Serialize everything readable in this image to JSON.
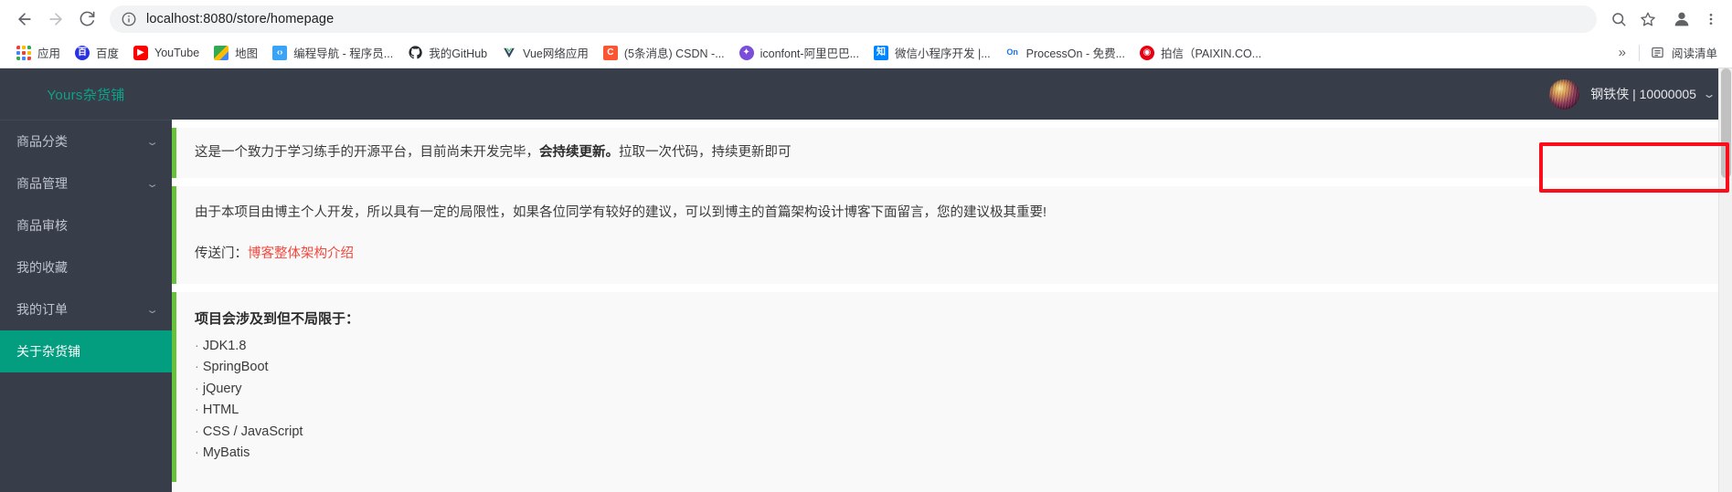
{
  "browser": {
    "url_display": "localhost:8080/store/homepage",
    "url_host": "localhost:8080",
    "url_path": "/store/homepage",
    "nav": {
      "back": "back-button",
      "forward": "forward-button",
      "reload": "reload-button"
    },
    "omnibox_actions": [
      "zoom-icon",
      "bookmark-star-icon"
    ],
    "profile": "profile-avatar-icon",
    "menu": "browser-menu-icon",
    "bookmarks": [
      {
        "label": "应用",
        "icon": "apps-grid-icon",
        "ico_class": "ico-apps",
        "glyph": ""
      },
      {
        "label": "百度",
        "icon": "baidu-icon",
        "ico_class": "ico-baidu",
        "glyph": "度"
      },
      {
        "label": "YouTube",
        "icon": "youtube-icon",
        "ico_class": "ico-youtube",
        "glyph": "▶"
      },
      {
        "label": "地图",
        "icon": "google-maps-icon",
        "ico_class": "ico-maps",
        "glyph": ""
      },
      {
        "label": "编程导航 - 程序员...",
        "icon": "code-nav-icon",
        "ico_class": "ico-code",
        "glyph": "‹›"
      },
      {
        "label": "我的GitHub",
        "icon": "github-icon",
        "ico_class": "ico-github",
        "glyph": ""
      },
      {
        "label": "Vue网络应用",
        "icon": "vue-icon",
        "ico_class": "ico-vue",
        "glyph": "▼"
      },
      {
        "label": "(5条消息) CSDN -...",
        "icon": "csdn-icon",
        "ico_class": "ico-csdn",
        "glyph": "C"
      },
      {
        "label": "iconfont-阿里巴巴...",
        "icon": "iconfont-icon",
        "ico_class": "ico-iconfont",
        "glyph": "✦"
      },
      {
        "label": "微信小程序开发 |...",
        "icon": "zhihu-icon",
        "ico_class": "ico-zhihu",
        "glyph": "知"
      },
      {
        "label": "ProcessOn - 免费...",
        "icon": "processon-icon",
        "ico_class": "ico-processon",
        "glyph": "On"
      },
      {
        "label": "拍信（PAIXIN.CO...",
        "icon": "paixin-icon",
        "ico_class": "ico-paixin",
        "glyph": "◉"
      }
    ],
    "overflow_label": "»",
    "reading_list": {
      "label": "阅读清单",
      "icon": "reading-list-icon",
      "glyph": "▤"
    }
  },
  "sidebar": {
    "brand": "Yours杂货铺",
    "items": [
      {
        "label": "商品分类",
        "has_chevron": true,
        "active": false
      },
      {
        "label": "商品管理",
        "has_chevron": true,
        "active": false
      },
      {
        "label": "商品审核",
        "has_chevron": false,
        "active": false
      },
      {
        "label": "我的收藏",
        "has_chevron": false,
        "active": false
      },
      {
        "label": "我的订单",
        "has_chevron": true,
        "active": false
      },
      {
        "label": "关于杂货铺",
        "has_chevron": false,
        "active": true
      }
    ]
  },
  "topbar": {
    "user_name": "钢铁侠 | 10000005",
    "chevron": "⌄",
    "highlight_color": "#fc0d1b"
  },
  "main": {
    "alert1": {
      "text_before": "这是一个致力于学习练手的开源平台，目前尚未开发完毕，",
      "text_bold": "会持续更新。",
      "text_after": "拉取一次代码，持续更新即可"
    },
    "alert2": {
      "line1": "由于本项目由博主个人开发，所以具有一定的局限性，如果各位同学有较好的建议，可以到博主的首篇架构设计博客下面留言，您的建议极其重要!",
      "line2_prefix": "传送门：",
      "line2_link": "博客整体架构介绍"
    },
    "alert3": {
      "title": "项目会涉及到但不局限于：",
      "items": [
        "JDK1.8",
        "SpringBoot",
        "jQuery",
        "HTML",
        "CSS / JavaScript",
        "MyBatis"
      ],
      "bullet": "·"
    }
  },
  "colors": {
    "sidebar_bg": "#373d49",
    "sidebar_active": "#039e80",
    "brand": "#0ca287",
    "alert_accent": "#67c23a",
    "link_red": "#f1493f",
    "highlight_red": "#fc0d1b"
  }
}
